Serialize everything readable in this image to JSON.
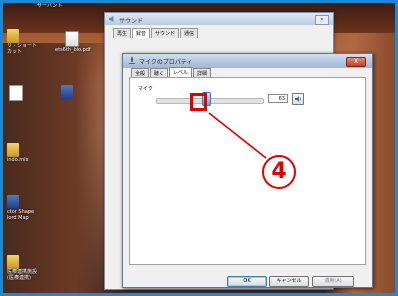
{
  "desktop": {
    "icons": [
      {
        "label": "リ - ショート\nカット",
        "kind": "folder"
      },
      {
        "label": "ets6th_bio.pdf",
        "kind": "pdf"
      },
      {
        "label": "",
        "kind": "doc"
      },
      {
        "label": "",
        "kind": "shortcut"
      },
      {
        "label": "indo.mIx",
        "kind": "folder"
      },
      {
        "label": "ctor Shape\nlord Map",
        "kind": "shortcut"
      },
      {
        "label": "",
        "kind": "folder"
      },
      {
        "label": "医療連携施設\n(医療連携)",
        "kind": "folder"
      }
    ],
    "top_label": "サーバント"
  },
  "sound_window": {
    "title": "サウンド",
    "close_label": "✕",
    "tabs": [
      "再生",
      "録音",
      "サウンド",
      "通信"
    ],
    "active_tab": 1
  },
  "mic_window": {
    "title": "マイクのプロパティ",
    "close_label": "X",
    "tabs": [
      "全般",
      "聴く",
      "レベル",
      "詳細"
    ],
    "active_tab": 2,
    "level_group_label": "マイク",
    "level_value": "63",
    "level_fraction": 0.63,
    "buttons": {
      "ok": "OK",
      "cancel": "キャンセル",
      "apply": "適用(A)"
    }
  },
  "annotation": {
    "number": "4",
    "color": "#e00000"
  }
}
